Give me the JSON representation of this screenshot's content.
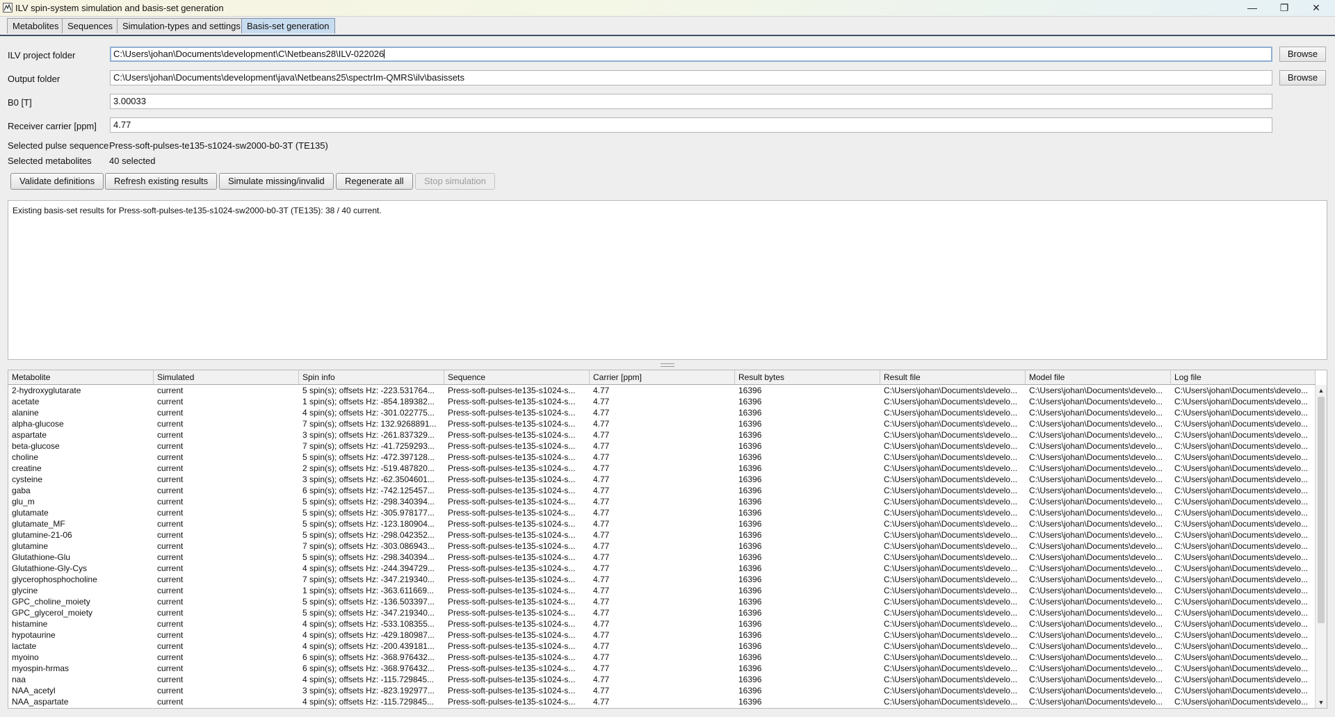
{
  "window": {
    "title": "ILV spin-system simulation and basis-set generation",
    "minimize": "—",
    "maximize": "❐",
    "close": "✕"
  },
  "tabs": [
    "Metabolites",
    "Sequences",
    "Simulation-types and settings",
    "Basis-set generation"
  ],
  "form": {
    "project_label": "ILV project folder",
    "project_value": "C:\\Users\\johan\\Documents\\development\\C\\Netbeans28\\ILV-022026",
    "output_label": "Output folder",
    "output_value": "C:\\Users\\johan\\Documents\\development\\java\\Netbeans25\\spectrIm-QMRS\\ilv\\basissets",
    "b0_label": "B0 [T]",
    "b0_value": "3.00033",
    "carrier_label": "Receiver carrier [ppm]",
    "carrier_value": "4.77",
    "browse_label": "Browse",
    "pulse_label": "Selected pulse sequence",
    "pulse_value": "Press-soft-pulses-te135-s1024-sw2000-b0-3T (TE135)",
    "metab_label": "Selected metabolites",
    "metab_value": "40 selected"
  },
  "actions": {
    "validate": "Validate definitions",
    "refresh": "Refresh existing results",
    "simulate": "Simulate missing/invalid",
    "regenerate": "Regenerate all",
    "stop": "Stop simulation"
  },
  "log_text": "Existing basis-set results for Press-soft-pulses-te135-s1024-sw2000-b0-3T (TE135): 38 / 40 current.",
  "scroll_up": "▲",
  "scroll_down": "▼",
  "table": {
    "columns": [
      "Metabolite",
      "Simulated",
      "Spin info",
      "Sequence",
      "Carrier [ppm]",
      "Result bytes",
      "Result file",
      "Model file",
      "Log file"
    ],
    "rows": [
      [
        "2-hydroxyglutarate",
        "current",
        "5 spin(s); offsets Hz: -223.531764...",
        "Press-soft-pulses-te135-s1024-s...",
        "4.77",
        "16396",
        "C:\\Users\\johan\\Documents\\develo...",
        "C:\\Users\\johan\\Documents\\develo...",
        "C:\\Users\\johan\\Documents\\develo..."
      ],
      [
        "acetate",
        "current",
        "1 spin(s); offsets Hz: -854.189382...",
        "Press-soft-pulses-te135-s1024-s...",
        "4.77",
        "16396",
        "C:\\Users\\johan\\Documents\\develo...",
        "C:\\Users\\johan\\Documents\\develo...",
        "C:\\Users\\johan\\Documents\\develo..."
      ],
      [
        "alanine",
        "current",
        "4 spin(s); offsets Hz: -301.022775...",
        "Press-soft-pulses-te135-s1024-s...",
        "4.77",
        "16396",
        "C:\\Users\\johan\\Documents\\develo...",
        "C:\\Users\\johan\\Documents\\develo...",
        "C:\\Users\\johan\\Documents\\develo..."
      ],
      [
        "alpha-glucose",
        "current",
        "7 spin(s); offsets Hz: 132.9268891...",
        "Press-soft-pulses-te135-s1024-s...",
        "4.77",
        "16396",
        "C:\\Users\\johan\\Documents\\develo...",
        "C:\\Users\\johan\\Documents\\develo...",
        "C:\\Users\\johan\\Documents\\develo..."
      ],
      [
        "aspartate",
        "current",
        "3 spin(s); offsets Hz: -261.837329...",
        "Press-soft-pulses-te135-s1024-s...",
        "4.77",
        "16396",
        "C:\\Users\\johan\\Documents\\develo...",
        "C:\\Users\\johan\\Documents\\develo...",
        "C:\\Users\\johan\\Documents\\develo..."
      ],
      [
        "beta-glucose",
        "current",
        "7 spin(s); offsets Hz: -41.7259293...",
        "Press-soft-pulses-te135-s1024-s...",
        "4.77",
        "16396",
        "C:\\Users\\johan\\Documents\\develo...",
        "C:\\Users\\johan\\Documents\\develo...",
        "C:\\Users\\johan\\Documents\\develo..."
      ],
      [
        "choline",
        "current",
        "5 spin(s); offsets Hz: -472.397128...",
        "Press-soft-pulses-te135-s1024-s...",
        "4.77",
        "16396",
        "C:\\Users\\johan\\Documents\\develo...",
        "C:\\Users\\johan\\Documents\\develo...",
        "C:\\Users\\johan\\Documents\\develo..."
      ],
      [
        "creatine",
        "current",
        "2 spin(s); offsets Hz: -519.487820...",
        "Press-soft-pulses-te135-s1024-s...",
        "4.77",
        "16396",
        "C:\\Users\\johan\\Documents\\develo...",
        "C:\\Users\\johan\\Documents\\develo...",
        "C:\\Users\\johan\\Documents\\develo..."
      ],
      [
        "cysteine",
        "current",
        "3 spin(s); offsets Hz: -62.3504601...",
        "Press-soft-pulses-te135-s1024-s...",
        "4.77",
        "16396",
        "C:\\Users\\johan\\Documents\\develo...",
        "C:\\Users\\johan\\Documents\\develo...",
        "C:\\Users\\johan\\Documents\\develo..."
      ],
      [
        "gaba",
        "current",
        "6 spin(s); offsets Hz: -742.125457...",
        "Press-soft-pulses-te135-s1024-s...",
        "4.77",
        "16396",
        "C:\\Users\\johan\\Documents\\develo...",
        "C:\\Users\\johan\\Documents\\develo...",
        "C:\\Users\\johan\\Documents\\develo..."
      ],
      [
        "glu_m",
        "current",
        "5 spin(s); offsets Hz: -298.340394...",
        "Press-soft-pulses-te135-s1024-s...",
        "4.77",
        "16396",
        "C:\\Users\\johan\\Documents\\develo...",
        "C:\\Users\\johan\\Documents\\develo...",
        "C:\\Users\\johan\\Documents\\develo..."
      ],
      [
        "glutamate",
        "current",
        "5 spin(s); offsets Hz: -305.978177...",
        "Press-soft-pulses-te135-s1024-s...",
        "4.77",
        "16396",
        "C:\\Users\\johan\\Documents\\develo...",
        "C:\\Users\\johan\\Documents\\develo...",
        "C:\\Users\\johan\\Documents\\develo..."
      ],
      [
        "glutamate_MF",
        "current",
        "5 spin(s); offsets Hz: -123.180904...",
        "Press-soft-pulses-te135-s1024-s...",
        "4.77",
        "16396",
        "C:\\Users\\johan\\Documents\\develo...",
        "C:\\Users\\johan\\Documents\\develo...",
        "C:\\Users\\johan\\Documents\\develo..."
      ],
      [
        "glutamine-21-06",
        "current",
        "5 spin(s); offsets Hz: -298.042352...",
        "Press-soft-pulses-te135-s1024-s...",
        "4.77",
        "16396",
        "C:\\Users\\johan\\Documents\\develo...",
        "C:\\Users\\johan\\Documents\\develo...",
        "C:\\Users\\johan\\Documents\\develo..."
      ],
      [
        "glutamine",
        "current",
        "7 spin(s); offsets Hz: -303.086943...",
        "Press-soft-pulses-te135-s1024-s...",
        "4.77",
        "16396",
        "C:\\Users\\johan\\Documents\\develo...",
        "C:\\Users\\johan\\Documents\\develo...",
        "C:\\Users\\johan\\Documents\\develo..."
      ],
      [
        "Glutathione-Glu",
        "current",
        "5 spin(s); offsets Hz: -298.340394...",
        "Press-soft-pulses-te135-s1024-s...",
        "4.77",
        "16396",
        "C:\\Users\\johan\\Documents\\develo...",
        "C:\\Users\\johan\\Documents\\develo...",
        "C:\\Users\\johan\\Documents\\develo..."
      ],
      [
        "Glutathione-Gly-Cys",
        "current",
        "4 spin(s); offsets Hz: -244.394729...",
        "Press-soft-pulses-te135-s1024-s...",
        "4.77",
        "16396",
        "C:\\Users\\johan\\Documents\\develo...",
        "C:\\Users\\johan\\Documents\\develo...",
        "C:\\Users\\johan\\Documents\\develo..."
      ],
      [
        "glycerophosphocholine",
        "current",
        "7 spin(s); offsets Hz: -347.219340...",
        "Press-soft-pulses-te135-s1024-s...",
        "4.77",
        "16396",
        "C:\\Users\\johan\\Documents\\develo...",
        "C:\\Users\\johan\\Documents\\develo...",
        "C:\\Users\\johan\\Documents\\develo..."
      ],
      [
        "glycine",
        "current",
        "1 spin(s); offsets Hz: -363.611669...",
        "Press-soft-pulses-te135-s1024-s...",
        "4.77",
        "16396",
        "C:\\Users\\johan\\Documents\\develo...",
        "C:\\Users\\johan\\Documents\\develo...",
        "C:\\Users\\johan\\Documents\\develo..."
      ],
      [
        "GPC_choline_moiety",
        "current",
        "5 spin(s); offsets Hz: -136.503397...",
        "Press-soft-pulses-te135-s1024-s...",
        "4.77",
        "16396",
        "C:\\Users\\johan\\Documents\\develo...",
        "C:\\Users\\johan\\Documents\\develo...",
        "C:\\Users\\johan\\Documents\\develo..."
      ],
      [
        "GPC_glycerol_moiety",
        "current",
        "5 spin(s); offsets Hz: -347.219340...",
        "Press-soft-pulses-te135-s1024-s...",
        "4.77",
        "16396",
        "C:\\Users\\johan\\Documents\\develo...",
        "C:\\Users\\johan\\Documents\\develo...",
        "C:\\Users\\johan\\Documents\\develo..."
      ],
      [
        "histamine",
        "current",
        "4 spin(s); offsets Hz: -533.108355...",
        "Press-soft-pulses-te135-s1024-s...",
        "4.77",
        "16396",
        "C:\\Users\\johan\\Documents\\develo...",
        "C:\\Users\\johan\\Documents\\develo...",
        "C:\\Users\\johan\\Documents\\develo..."
      ],
      [
        "hypotaurine",
        "current",
        "4 spin(s); offsets Hz: -429.180987...",
        "Press-soft-pulses-te135-s1024-s...",
        "4.77",
        "16396",
        "C:\\Users\\johan\\Documents\\develo...",
        "C:\\Users\\johan\\Documents\\develo...",
        "C:\\Users\\johan\\Documents\\develo..."
      ],
      [
        "lactate",
        "current",
        "4 spin(s); offsets Hz: -200.439181...",
        "Press-soft-pulses-te135-s1024-s...",
        "4.77",
        "16396",
        "C:\\Users\\johan\\Documents\\develo...",
        "C:\\Users\\johan\\Documents\\develo...",
        "C:\\Users\\johan\\Documents\\develo..."
      ],
      [
        "myoino",
        "current",
        "6 spin(s); offsets Hz: -368.976432...",
        "Press-soft-pulses-te135-s1024-s...",
        "4.77",
        "16396",
        "C:\\Users\\johan\\Documents\\develo...",
        "C:\\Users\\johan\\Documents\\develo...",
        "C:\\Users\\johan\\Documents\\develo..."
      ],
      [
        "myospin-hrmas",
        "current",
        "6 spin(s); offsets Hz: -368.976432...",
        "Press-soft-pulses-te135-s1024-s...",
        "4.77",
        "16396",
        "C:\\Users\\johan\\Documents\\develo...",
        "C:\\Users\\johan\\Documents\\develo...",
        "C:\\Users\\johan\\Documents\\develo..."
      ],
      [
        "naa",
        "current",
        "4 spin(s); offsets Hz: -115.729845...",
        "Press-soft-pulses-te135-s1024-s...",
        "4.77",
        "16396",
        "C:\\Users\\johan\\Documents\\develo...",
        "C:\\Users\\johan\\Documents\\develo...",
        "C:\\Users\\johan\\Documents\\develo..."
      ],
      [
        "NAA_acetyl",
        "current",
        "3 spin(s); offsets Hz: -823.192977...",
        "Press-soft-pulses-te135-s1024-s...",
        "4.77",
        "16396",
        "C:\\Users\\johan\\Documents\\develo...",
        "C:\\Users\\johan\\Documents\\develo...",
        "C:\\Users\\johan\\Documents\\develo..."
      ],
      [
        "NAA_aspartate",
        "current",
        "4 spin(s); offsets Hz: -115.729845...",
        "Press-soft-pulses-te135-s1024-s...",
        "4.77",
        "16396",
        "C:\\Users\\johan\\Documents\\develo...",
        "C:\\Users\\johan\\Documents\\develo...",
        "C:\\Users\\johan\\Documents\\develo..."
      ]
    ]
  }
}
